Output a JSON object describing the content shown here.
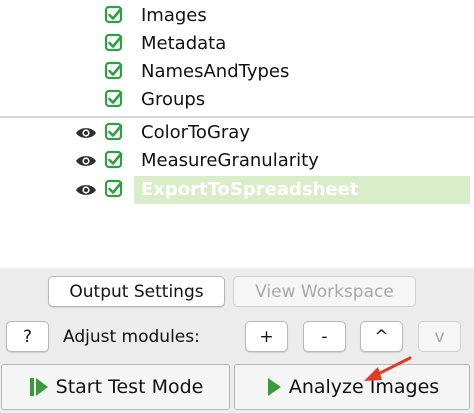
{
  "pipeline": {
    "input_modules": [
      {
        "label": "Images"
      },
      {
        "label": "Metadata"
      },
      {
        "label": "NamesAndTypes"
      },
      {
        "label": "Groups"
      }
    ],
    "analysis_modules": [
      {
        "label": "ColorToGray",
        "selected": false
      },
      {
        "label": "MeasureGranularity",
        "selected": false
      },
      {
        "label": "ExportToSpreadsheet",
        "selected": true
      }
    ]
  },
  "buttons": {
    "output_settings": "Output Settings",
    "view_workspace": "View Workspace"
  },
  "adjust": {
    "help": "?",
    "label": "Adjust modules:",
    "add": "+",
    "remove": "-",
    "up": "^",
    "down": "v"
  },
  "actions": {
    "start_test_mode": "Start Test Mode",
    "analyze_images": "Analyze Images"
  },
  "colors": {
    "check_green": "#2f9e44",
    "selected_row": "#d9edc9",
    "play_green": "#3c9a3c",
    "arrow_red": "#e03b24"
  }
}
